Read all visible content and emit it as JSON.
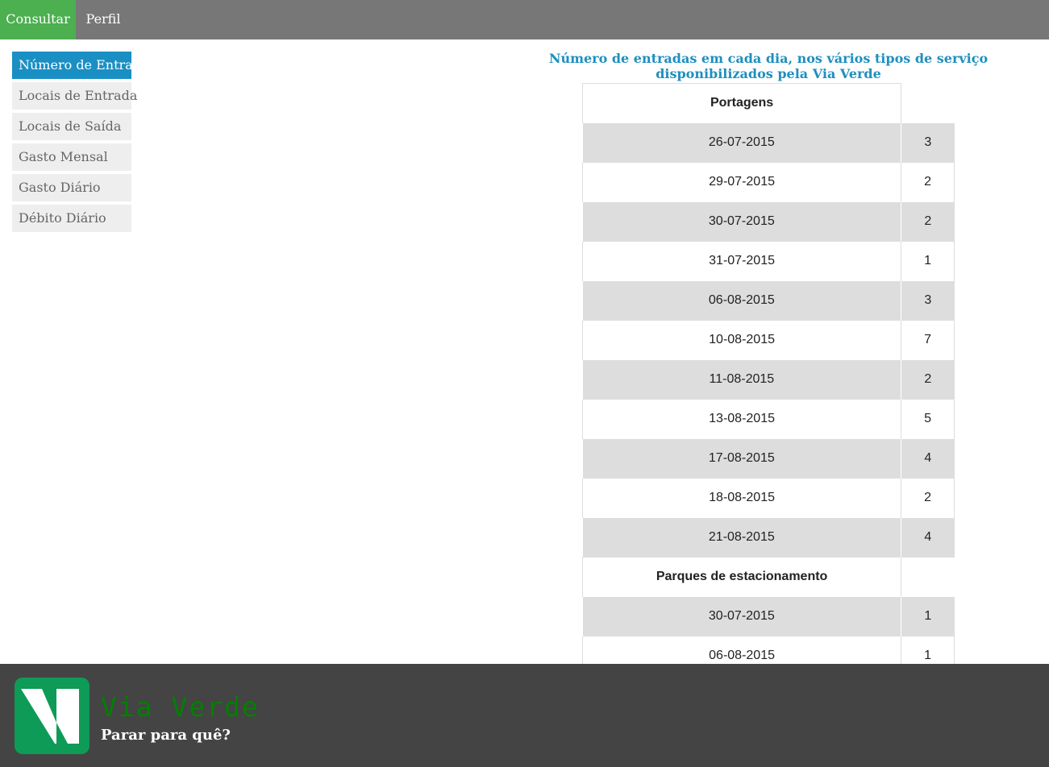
{
  "topnav": {
    "tabs": [
      {
        "label": "Consultar",
        "active": true
      },
      {
        "label": "Perfil",
        "active": false
      }
    ]
  },
  "sidebar": {
    "items": [
      {
        "label": "Número de Entradas",
        "active": true
      },
      {
        "label": "Locais de Entrada",
        "active": false
      },
      {
        "label": "Locais de Saída",
        "active": false
      },
      {
        "label": "Gasto Mensal",
        "active": false
      },
      {
        "label": "Gasto Diário",
        "active": false
      },
      {
        "label": "Débito Diário",
        "active": false
      }
    ]
  },
  "main": {
    "heading": "Número de entradas em cada dia, nos vários tipos de serviço disponibilizados pela Via Verde",
    "sections": [
      {
        "title": "Portagens",
        "rows": [
          {
            "date": "26-07-2015",
            "count": "3"
          },
          {
            "date": "29-07-2015",
            "count": "2"
          },
          {
            "date": "30-07-2015",
            "count": "2"
          },
          {
            "date": "31-07-2015",
            "count": "1"
          },
          {
            "date": "06-08-2015",
            "count": "3"
          },
          {
            "date": "10-08-2015",
            "count": "7"
          },
          {
            "date": "11-08-2015",
            "count": "2"
          },
          {
            "date": "13-08-2015",
            "count": "5"
          },
          {
            "date": "17-08-2015",
            "count": "4"
          },
          {
            "date": "18-08-2015",
            "count": "2"
          },
          {
            "date": "21-08-2015",
            "count": "4"
          }
        ]
      },
      {
        "title": "Parques de estacionamento",
        "rows": [
          {
            "date": "30-07-2015",
            "count": "1"
          },
          {
            "date": "06-08-2015",
            "count": "1"
          }
        ]
      }
    ]
  },
  "footer": {
    "logo_icon": "via-verde-logo",
    "brand": "Via Verde",
    "slogan": "Parar para quê?"
  },
  "colors": {
    "nav_bg": "#777777",
    "nav_active": "#4caf50",
    "sidebar_active": "#1a8fc4",
    "heading": "#1e8fbf",
    "row_shade": "#dddddd",
    "footer_bg": "#444444",
    "brand_text": "#008000",
    "logo_bg": "#0e9a57"
  }
}
